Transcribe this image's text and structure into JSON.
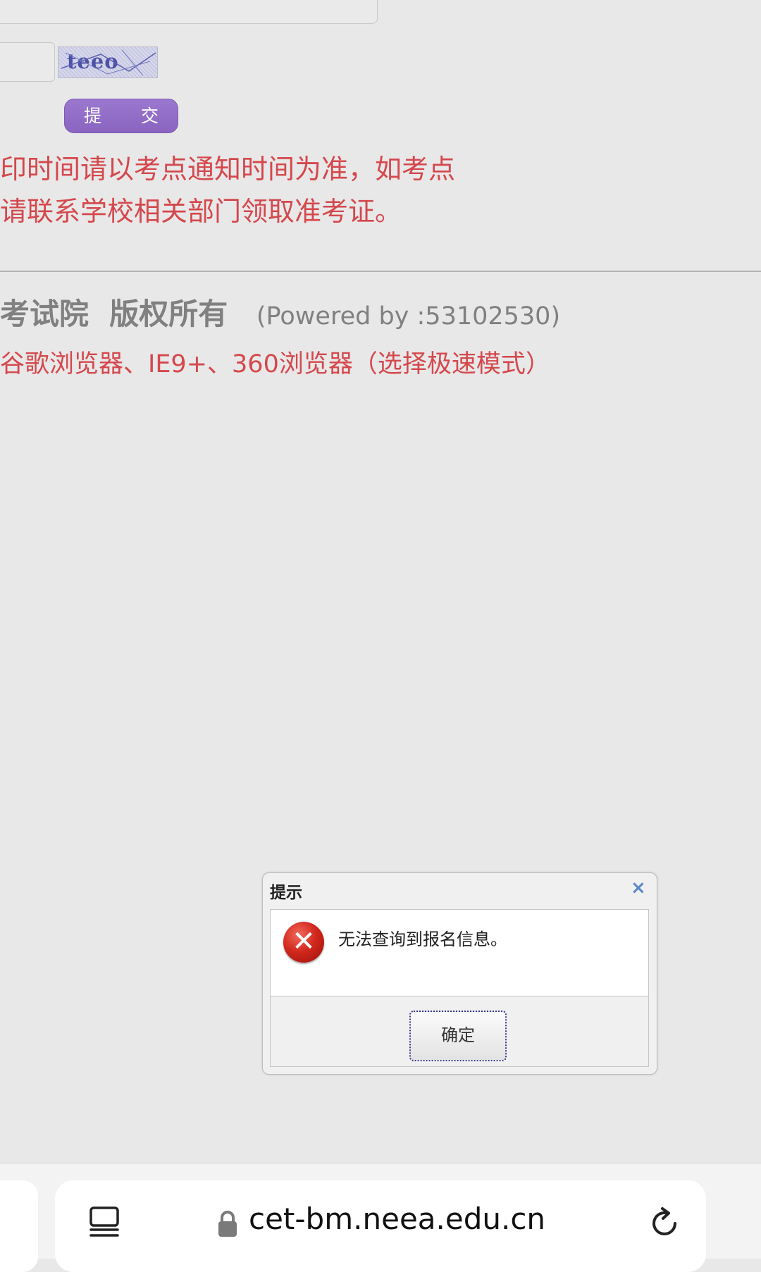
{
  "form": {
    "captcha_text": "teeo",
    "submit_label": "提 交"
  },
  "notice": {
    "line1": "印时间请以考点通知时间为准，如考点",
    "line2": "请联系学校相关部门领取准考证。"
  },
  "footer": {
    "copyright": "考试院  版权所有",
    "powered": "(Powered by :53102530)",
    "browser_note": "谷歌浏览器、IE9+、360浏览器（选择极速模式）"
  },
  "dialog": {
    "title": "提示",
    "close_glyph": "×",
    "message": "无法查询到报名信息。",
    "ok_label": "确定",
    "icon": "error-icon"
  },
  "browser": {
    "url": "cet-bm.neea.edu.cn",
    "icons": [
      "tabs-icon",
      "lock-icon",
      "reload-icon"
    ]
  },
  "colors": {
    "accent_purple": "#8a64c1",
    "notice_red": "#d4484c",
    "close_blue": "#5b86c9"
  }
}
